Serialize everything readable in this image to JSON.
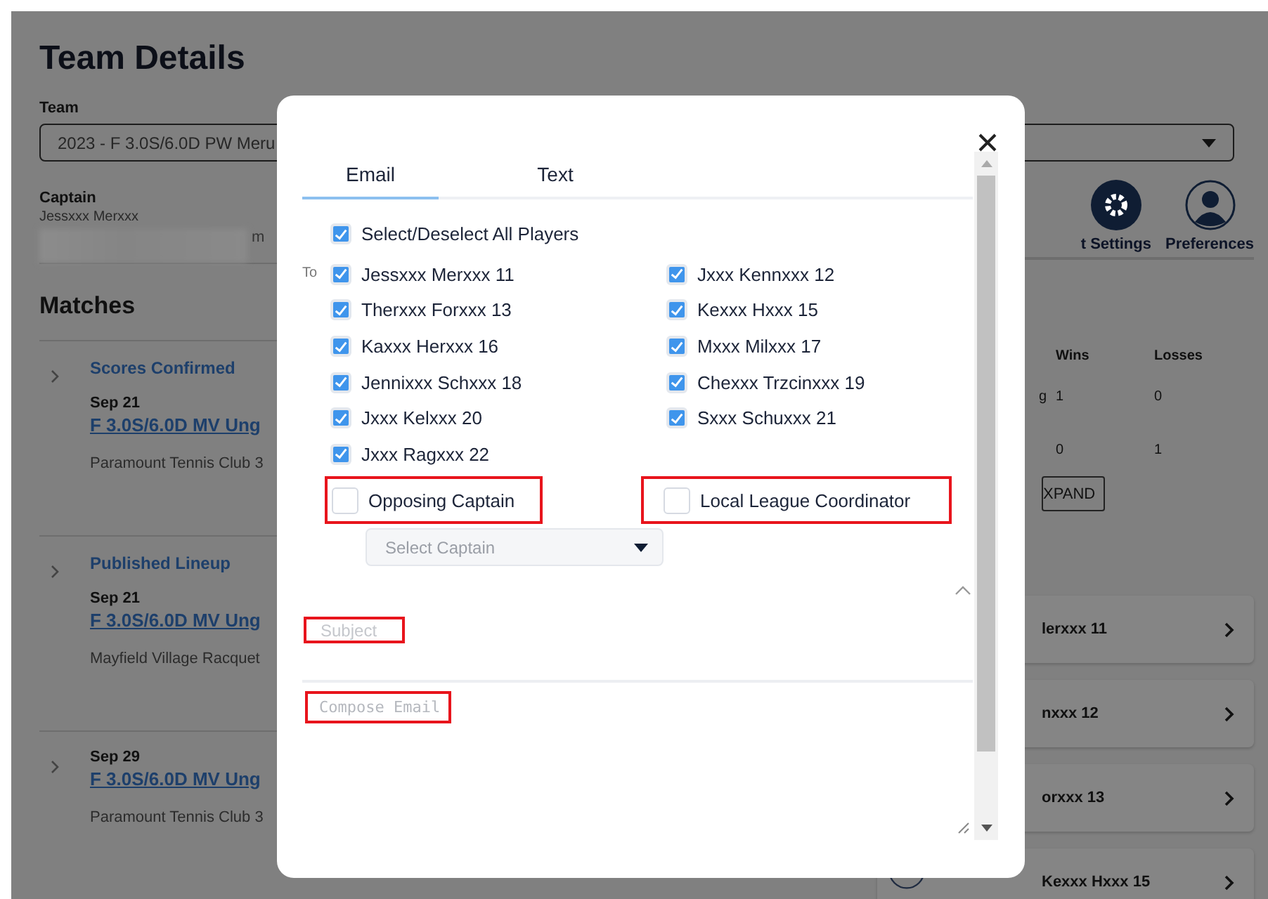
{
  "page": {
    "title": "Team Details",
    "team_label": "Team",
    "team_select": "2023 - F 3.0S/6.0D PW Meru",
    "captain_label": "Captain",
    "captain_name": "Jessxxx Merxxx",
    "captain_contact_fragment": "m",
    "matches_title": "Matches",
    "matches": [
      {
        "status": "Scores Confirmed",
        "date": "Sep 21",
        "name": "F 3.0S/6.0D MV Ung",
        "venue": "Paramount Tennis Club 3"
      },
      {
        "status": "Published Lineup",
        "date": "Sep 21",
        "name": "F 3.0S/6.0D MV Ung",
        "venue": "Mayfield Village Racquet"
      },
      {
        "date": "Sep 29",
        "name": "F 3.0S/6.0D MV Ung",
        "venue": "Paramount Tennis Club 3"
      }
    ],
    "actions": [
      {
        "kind": "settings",
        "label": "t Settings"
      },
      {
        "kind": "person",
        "label": "Preferences"
      }
    ],
    "stats": {
      "columns": [
        "Wins",
        "Losses"
      ],
      "rows": [
        {
          "label": "g",
          "wins": "1",
          "losses": "0"
        },
        {
          "wins": "0",
          "losses": "1"
        }
      ]
    },
    "expand_button": "XPAND",
    "players": [
      {
        "name": "lerxxx 11"
      },
      {
        "name": "nxxx 12"
      },
      {
        "name": "orxxx 13"
      },
      {
        "name": "Kexxx Hxxx 15"
      }
    ]
  },
  "modal": {
    "tabs": [
      {
        "label": "Email",
        "selected": true
      },
      {
        "label": "Text",
        "selected": false
      }
    ],
    "select_all": {
      "label": "Select/Deselect All Players",
      "checked": true
    },
    "to_label": "To",
    "recipients": [
      {
        "label": "Jessxxx Merxxx 11",
        "checked": true
      },
      {
        "label": "Jxxx Kennxxx 12",
        "checked": true
      },
      {
        "label": "Therxxx Forxxx 13",
        "checked": true
      },
      {
        "label": "Kexxx Hxxx 15",
        "checked": true
      },
      {
        "label": "Kaxxx Herxxx 16",
        "checked": true
      },
      {
        "label": "Mxxx Milxxx 17",
        "checked": true
      },
      {
        "label": "Jennixxx Schxxx 18",
        "checked": true
      },
      {
        "label": "Chexxx Trzcinxxx 19",
        "checked": true
      },
      {
        "label": "Jxxx Kelxxx 20",
        "checked": true
      },
      {
        "label": "Sxxx Schuxxx 21",
        "checked": true
      },
      {
        "label": "Jxxx Ragxxx 22",
        "checked": true
      }
    ],
    "extra_recipients": [
      {
        "label": "Opposing Captain",
        "checked": false,
        "highlighted": true
      },
      {
        "label": "Local League Coordinator",
        "checked": false,
        "highlighted": true
      }
    ],
    "captain_select": {
      "placeholder": "Select Captain",
      "disabled": true
    },
    "subject": {
      "placeholder": "Subject",
      "highlighted": true
    },
    "message": {
      "placeholder": "Compose Email",
      "highlighted": true
    }
  }
}
